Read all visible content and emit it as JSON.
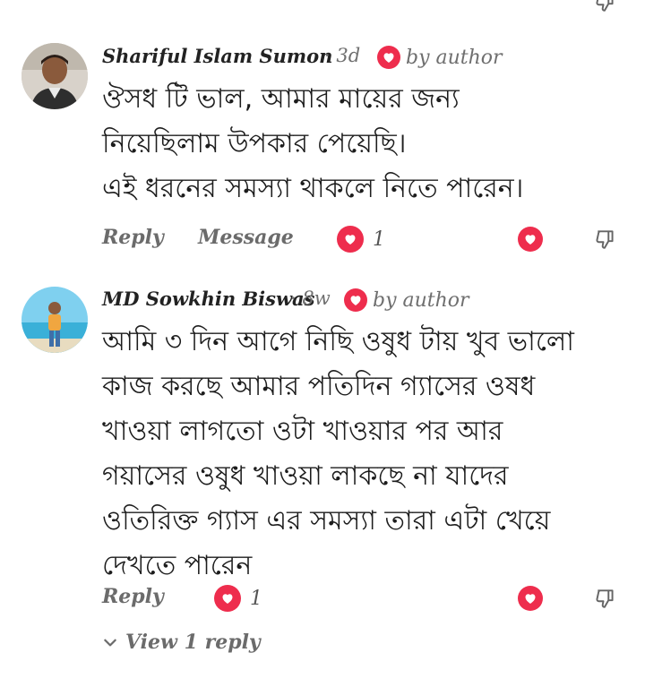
{
  "comments": [
    {
      "author": "Shariful Islam Sumon",
      "time": "· 3d",
      "badge": "by author",
      "lines": [
        "ঔসধ টি ভাল,  আমার মায়ের জন্য",
        "নিয়েছিলাম উপকার পেয়েছি।",
        "এই ধরনের সমস্যা থাকলে নিতে পারেন।"
      ],
      "reply_label": "Reply",
      "message_label": "Message",
      "like_count": "1"
    },
    {
      "author": "MD Sowkhin Biswas",
      "time": "· 8w",
      "badge": "by author",
      "lines": [
        "আমি ৩ দিন আগে নিছি ওষুধ টায় খুব ভালো",
        "কাজ করছে আমার পতিদিন গ্যাসের ওষধ",
        "খাওয়া লাগতো ওটা খাওয়ার পর আর",
        "গয়াসের ওষুধ  খাওয়া লাকছে না যাদের",
        "ওতিরিক্ত গ্যাস এর সমস্যা তারা এটা খেয়ে",
        "দেখতে পারেন"
      ],
      "reply_label": "Reply",
      "like_count": "1"
    }
  ],
  "view_replies": "View 1 reply",
  "colors": {
    "like": "#ee2d4d",
    "text": "#1c1c1c",
    "muted": "#6b6b6b"
  },
  "icons": [
    "heart-icon",
    "thumbs-down-icon",
    "chevron-down-icon"
  ]
}
